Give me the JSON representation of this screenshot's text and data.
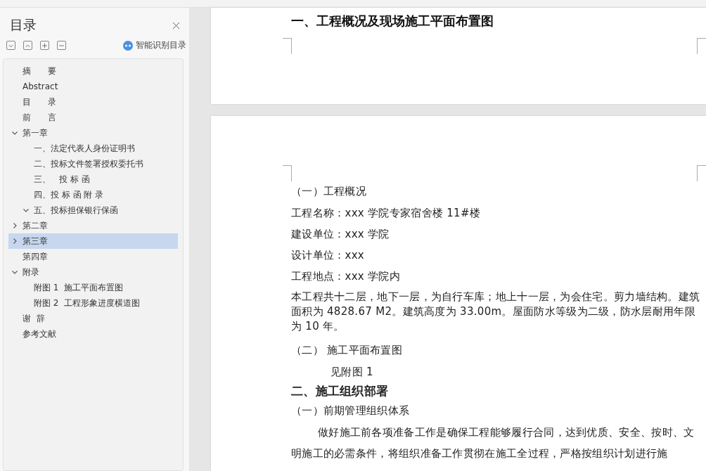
{
  "outline_panel": {
    "title": "目录",
    "smart_button": "智能识别目录",
    "items": [
      {
        "label": "摘　　要",
        "selected": false
      },
      {
        "label": "Abstract",
        "selected": false
      },
      {
        "label": "目　　录",
        "selected": false
      },
      {
        "label": "前　　言",
        "selected": false
      },
      {
        "label": "第一章",
        "selected": false,
        "expanded": true,
        "children": [
          {
            "label": "一、法定代表人身份证明书",
            "selected": false
          },
          {
            "label": "二、投标文件签署授权委托书",
            "selected": false
          },
          {
            "label": "三、　投 标 函",
            "selected": false
          },
          {
            "label": "四、投 标 函 附 录",
            "selected": false
          },
          {
            "label": "五、投标担保银行保函",
            "selected": false,
            "expanded": true
          }
        ]
      },
      {
        "label": "第二章",
        "selected": false,
        "expanded": false
      },
      {
        "label": "第三章",
        "selected": true,
        "expanded": false
      },
      {
        "label": "第四章",
        "selected": false
      },
      {
        "label": "附录",
        "selected": false,
        "expanded": true,
        "children": [
          {
            "label": "附图 1  施工平面布置图",
            "selected": false
          },
          {
            "label": "附图 2  工程形象进度横道图",
            "selected": false
          }
        ]
      },
      {
        "label": "谢  辞",
        "selected": false
      },
      {
        "label": "参考文献",
        "selected": false
      }
    ]
  },
  "document": {
    "page_1": {
      "heading": "一、工程概况及现场施工平面布置图"
    },
    "page_2": [
      {
        "kind": "subheading",
        "text": "（一）工程概况"
      },
      {
        "kind": "field",
        "text": "工程名称：xxx 学院专家宿舍楼 11#楼"
      },
      {
        "kind": "field",
        "text": "建设单位：xxx 学院"
      },
      {
        "kind": "field",
        "text": "设计单位：xxx"
      },
      {
        "kind": "field",
        "text": "工程地点：xxx 学院内"
      },
      {
        "kind": "body",
        "text": "本工程共十二层，地下一层，为自行车库；地上十一层，为会住宅。剪力墙结构。建筑面积为 4828.67 M2。建筑高度为 33.00m。屋面防水等级为二级，防水层耐用年限为 10 年。"
      },
      {
        "kind": "subheading",
        "text": "（二）  施工平面布置图"
      },
      {
        "kind": "indented",
        "text": "见附图 1"
      },
      {
        "kind": "heading",
        "text": "二、施工组织部署"
      },
      {
        "kind": "subheading_tight",
        "text": "（一）前期管理组织体系"
      },
      {
        "kind": "paragraph",
        "text": "做好施工前各项准备工作是确保工程能够履行合同，达到优质、安全、按时、文明施工的必需条件，将组织准备工作贯彻在施工全过程，严格按组织计划进行施"
      }
    ]
  }
}
